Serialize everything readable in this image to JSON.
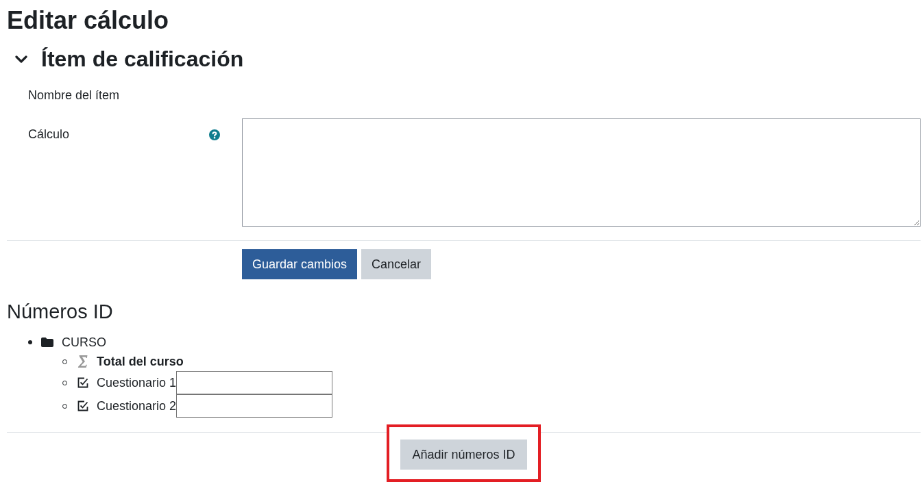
{
  "page_title": "Editar cálculo",
  "section": {
    "title": "Ítem de calificación",
    "expanded": true,
    "fields": [
      {
        "kind": "static",
        "label": "Nombre del ítem",
        "help": false
      },
      {
        "kind": "textarea",
        "label": "Cálculo",
        "help": true
      }
    ]
  },
  "form_buttons": [
    {
      "kind": "primary",
      "label": "Guardar cambios"
    },
    {
      "kind": "secondary",
      "label": "Cancelar"
    }
  ],
  "id_numbers": {
    "title": "Números ID",
    "tree": [
      {
        "kind": "category",
        "label": "CURSO",
        "children": [
          {
            "kind": "total",
            "label": "Total del curso"
          },
          {
            "kind": "quiz",
            "label": "Cuestionario 1"
          },
          {
            "kind": "quiz",
            "label": "Cuestionario 2"
          }
        ]
      }
    ]
  },
  "add_button": {
    "label": "Añadir números ID",
    "highlighted": true
  }
}
